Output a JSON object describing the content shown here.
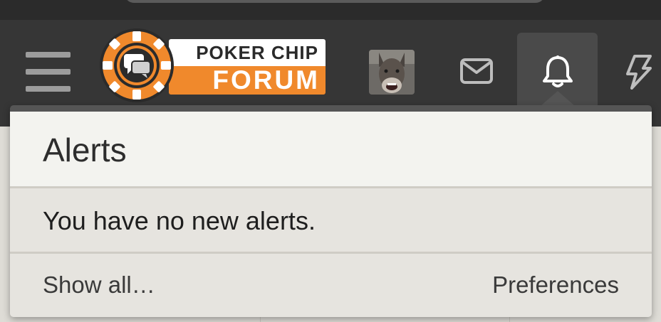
{
  "header": {
    "logo": {
      "line1": "POKER CHIP",
      "line2": "FORUM",
      "accent_color": "#f0892c"
    },
    "icons": {
      "menu": "hamburger-menu-icon",
      "avatar": "user-avatar-donkey",
      "inbox": "envelope-icon",
      "alerts": "bell-icon",
      "whats_new": "lightning-bolt-icon"
    }
  },
  "alerts_menu": {
    "title": "Alerts",
    "empty_message": "You have no new alerts.",
    "show_all_label": "Show all…",
    "preferences_label": "Preferences"
  },
  "colors": {
    "header_bg": "#363636",
    "menu_bg": "#e6e4df",
    "menu_header_bg": "#f3f3ef",
    "brand_orange": "#f0892c"
  }
}
